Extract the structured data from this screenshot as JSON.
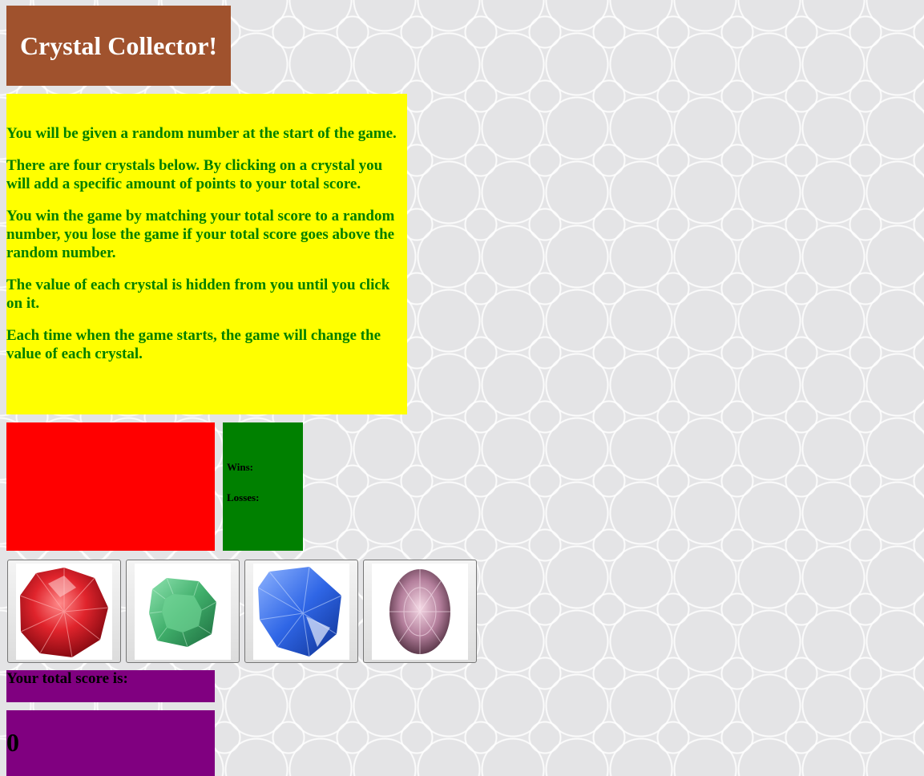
{
  "header": {
    "title": "Crystal Collector!"
  },
  "rules": [
    "You will be given a random number at the start of the game.",
    "There are four crystals below. By clicking on a crystal you will add a specific amount of points to your total score.",
    "You win the game by matching your total score to a random number, you lose the game if your total score goes above the random number.",
    "The value of each crystal is hidden from you until you click on it.",
    "Each time when the game starts, the game will change the value of each crystal."
  ],
  "target": {
    "value": ""
  },
  "stats": {
    "wins_label": "Wins:",
    "wins_value": "",
    "losses_label": "Losses:",
    "losses_value": ""
  },
  "crystals": [
    {
      "icon": "red-ruby-icon",
      "color": "#e0242c"
    },
    {
      "icon": "green-emerald-icon",
      "color": "#3fae6a"
    },
    {
      "icon": "blue-sapphire-icon",
      "color": "#2f66e6"
    },
    {
      "icon": "pink-gem-icon",
      "color": "#b47f9c"
    }
  ],
  "score": {
    "label": "Your total score is:",
    "value": "0"
  },
  "colors": {
    "title_bg": "#a0522d",
    "rules_bg": "#ffff00",
    "rules_text": "#008000",
    "target_bg": "#ff0000",
    "stats_bg": "#008000",
    "score_bg": "#800080"
  }
}
